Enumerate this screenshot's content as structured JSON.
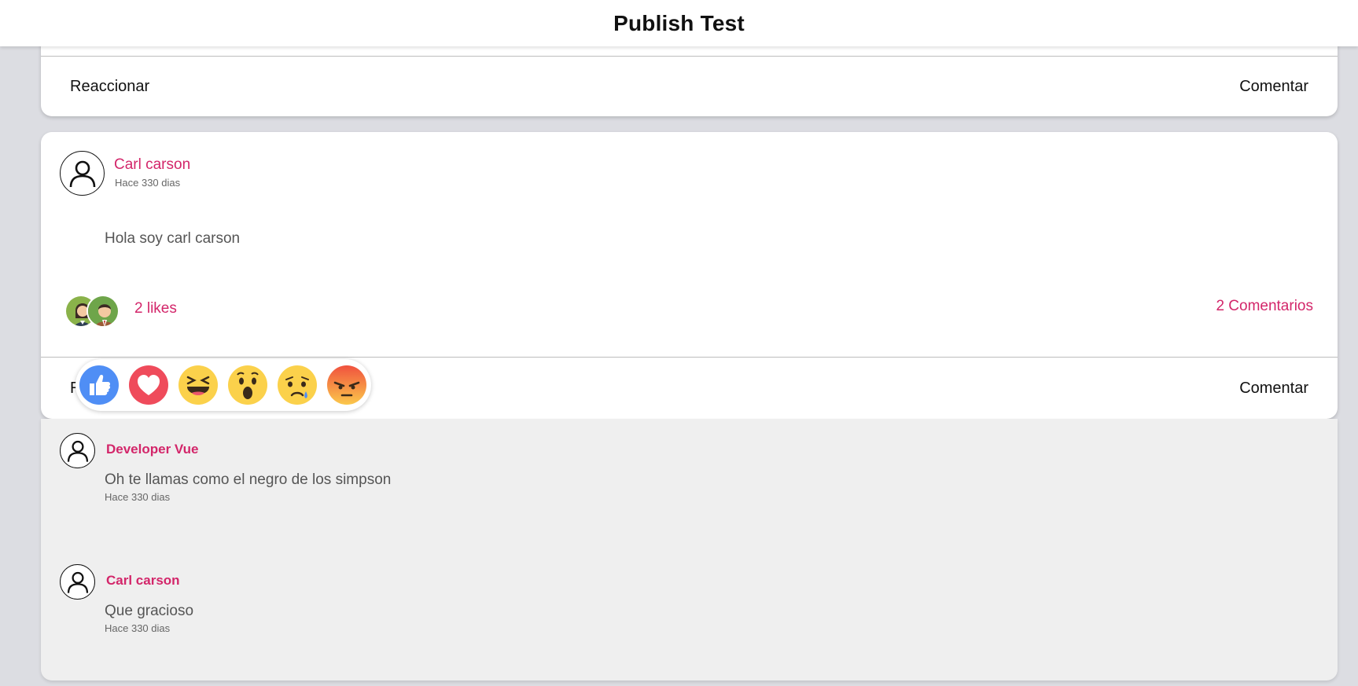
{
  "header": {
    "title": "Publish Test"
  },
  "previous_post": {
    "react_label": "Reaccionar",
    "comment_label": "Comentar"
  },
  "post": {
    "author": "Carl carson",
    "time": "Hace 330 dias",
    "text": "Hola soy carl carson",
    "likes": "2 likes",
    "comments_count": "2 Comentarios",
    "react_label": "R",
    "comment_label": "Comentar",
    "reactions": [
      "like",
      "love",
      "haha",
      "wow",
      "sad",
      "angry"
    ]
  },
  "comments": [
    {
      "author": "Developer Vue",
      "text": "Oh te llamas como el negro de los simpson",
      "time": "Hace 330 dias"
    },
    {
      "author": "Carl carson",
      "text": "Que gracioso",
      "time": "Hace 330 dias"
    }
  ],
  "colors": {
    "accent": "#d3266a",
    "background": "#dcdde2",
    "comments_bg": "#efefef"
  }
}
